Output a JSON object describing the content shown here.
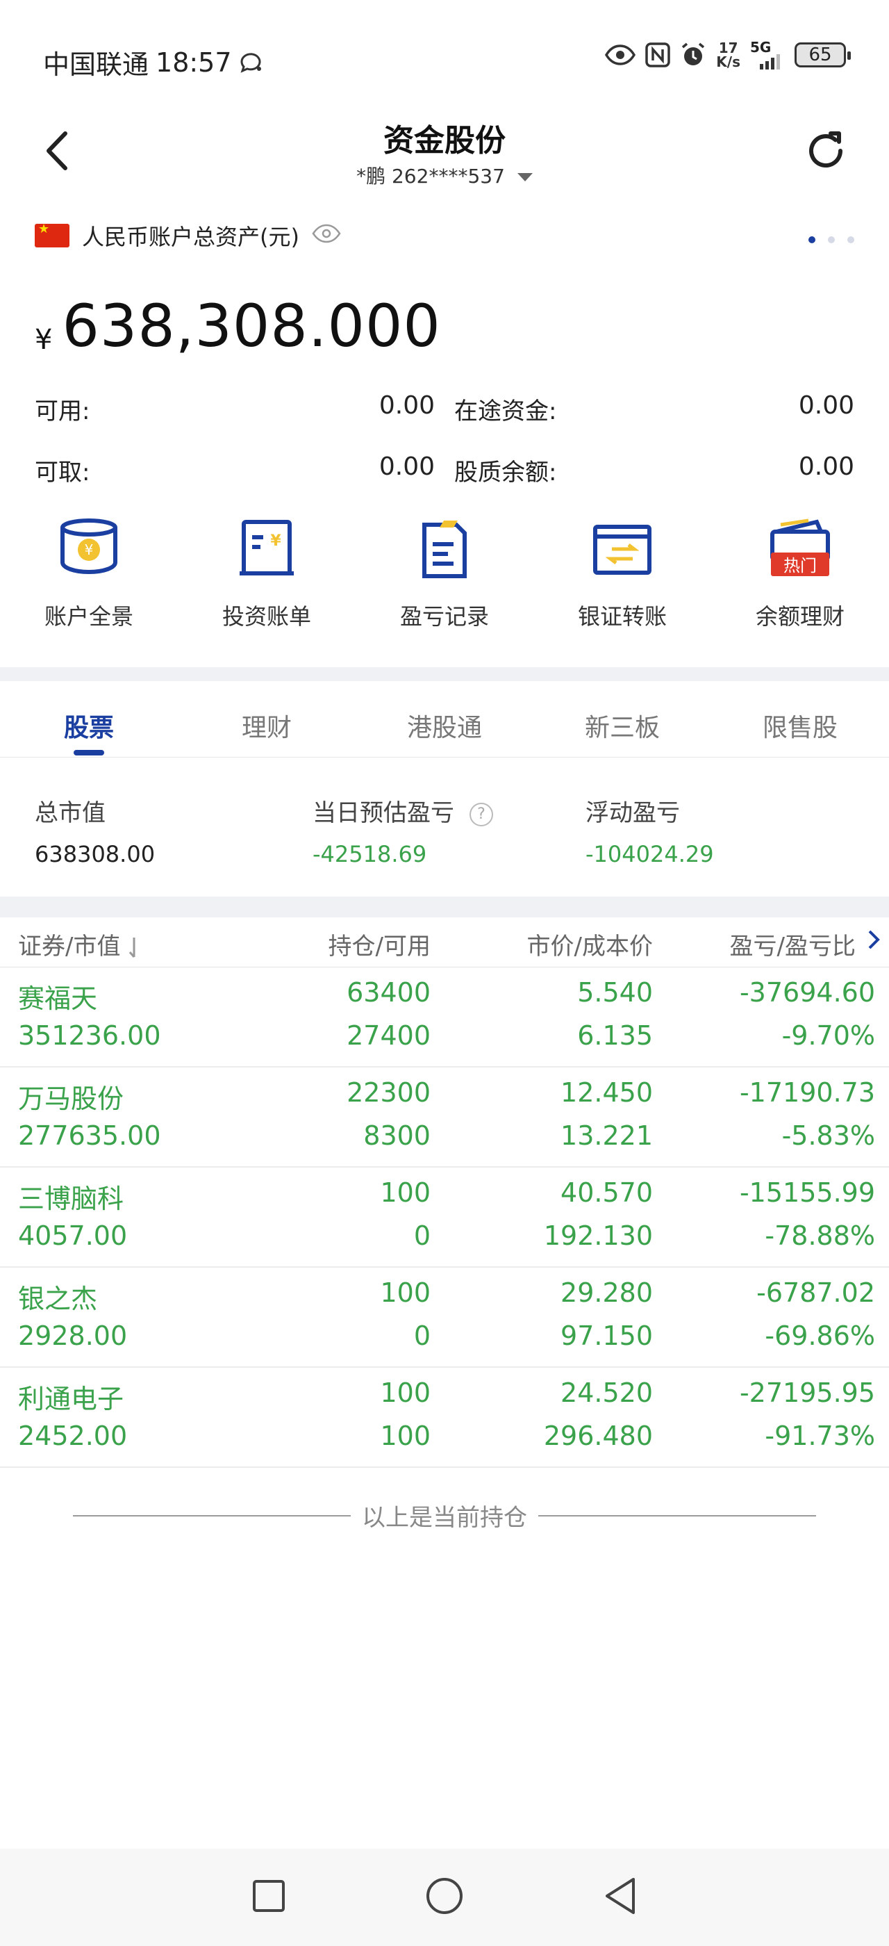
{
  "status_bar": {
    "carrier": "中国联通",
    "time": "18:57",
    "net_speed_value": "17",
    "net_speed_unit": "K/s",
    "network": "5G",
    "battery": "65"
  },
  "header": {
    "title": "资金股份",
    "account": "*鹏  262****537"
  },
  "assets": {
    "label": "人民币账户总资产(元)",
    "currency_symbol": "¥",
    "total": "638,308.000",
    "available_label": "可用:",
    "available_value": "0.00",
    "transit_label": "在途资金:",
    "transit_value": "0.00",
    "withdrawable_label": "可取:",
    "withdrawable_value": "0.00",
    "pledge_label": "股质余额:",
    "pledge_value": "0.00",
    "page_dots": 3,
    "active_dot": 0
  },
  "quick_actions": [
    {
      "label": "账户全景",
      "icon": "account-overview-icon"
    },
    {
      "label": "投资账单",
      "icon": "investment-bill-icon"
    },
    {
      "label": "盈亏记录",
      "icon": "pnl-record-icon"
    },
    {
      "label": "银证转账",
      "icon": "bank-transfer-icon"
    },
    {
      "label": "余额理财",
      "icon": "wallet-icon",
      "badge": "热门"
    }
  ],
  "tabs": [
    {
      "label": "股票",
      "active": true
    },
    {
      "label": "理财",
      "active": false
    },
    {
      "label": "港股通",
      "active": false
    },
    {
      "label": "新三板",
      "active": false
    },
    {
      "label": "限售股",
      "active": false
    }
  ],
  "summary": {
    "market_value_label": "总市值",
    "market_value": "638308.00",
    "daily_pnl_label": "当日预估盈亏",
    "daily_pnl": "-42518.69",
    "floating_pnl_label": "浮动盈亏",
    "floating_pnl": "-104024.29"
  },
  "table": {
    "headers": [
      "证券/市值",
      "持仓/可用",
      "市价/成本价",
      "盈亏/盈亏比"
    ],
    "rows": [
      {
        "name": "赛福天",
        "market_value": "351236.00",
        "position": "63400",
        "available": "27400",
        "price": "5.540",
        "cost": "6.135",
        "pnl": "-37694.60",
        "pnl_ratio": "-9.70%"
      },
      {
        "name": "万马股份",
        "market_value": "277635.00",
        "position": "22300",
        "available": "8300",
        "price": "12.450",
        "cost": "13.221",
        "pnl": "-17190.73",
        "pnl_ratio": "-5.83%"
      },
      {
        "name": "三博脑科",
        "market_value": "4057.00",
        "position": "100",
        "available": "0",
        "price": "40.570",
        "cost": "192.130",
        "pnl": "-15155.99",
        "pnl_ratio": "-78.88%"
      },
      {
        "name": "银之杰",
        "market_value": "2928.00",
        "position": "100",
        "available": "0",
        "price": "29.280",
        "cost": "97.150",
        "pnl": "-6787.02",
        "pnl_ratio": "-69.86%"
      },
      {
        "name": "利通电子",
        "market_value": "2452.00",
        "position": "100",
        "available": "100",
        "price": "24.520",
        "cost": "296.480",
        "pnl": "-27195.95",
        "pnl_ratio": "-91.73%"
      }
    ],
    "footer": "以上是当前持仓"
  },
  "colors": {
    "accent": "#1a3fa0",
    "loss_green": "#3aa24a",
    "badge_red": "#e03a2a",
    "icon_yellow": "#f2c230"
  }
}
